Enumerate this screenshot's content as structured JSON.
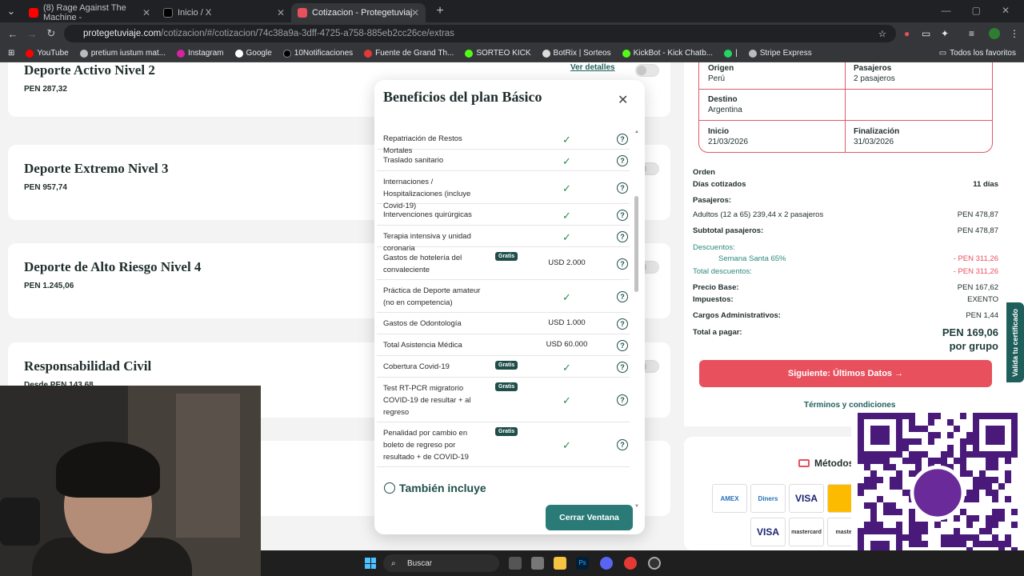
{
  "browser": {
    "tabs": [
      {
        "title": "(8) Rage Against The Machine -",
        "color": "#ff0000"
      },
      {
        "title": "Inicio / X",
        "color": "#000000"
      },
      {
        "title": "Cotizacion - Protegetuviaje.com",
        "color": "#e8505e"
      }
    ],
    "url_host": "protegetuviaje.com",
    "url_path": "/cotizacion/#/cotizacion/74c38a9a-3dff-4725-a758-885eb2cc26ce/extras",
    "bookmarks": [
      "YouTube",
      "pretium iustum mat...",
      "Instagram",
      "Google",
      "10Notificaciones",
      "Fuente de Grand Th...",
      "SORTEO KICK",
      "BotRix | Sorteos",
      "KickBot - Kick Chatb...",
      "|",
      "Stripe Express"
    ],
    "all_bookmarks": "Todos los favoritos"
  },
  "plans": [
    {
      "name": "Deporte Activo Nivel 2",
      "price": "PEN 287,32"
    },
    {
      "name": "Deporte Extremo Nivel 3",
      "price": "PEN 957,74"
    },
    {
      "name": "Deporte de Alto Riesgo Nivel 4",
      "price": "PEN 1.245,06"
    },
    {
      "name": "Responsabilidad Civil",
      "price": "Desde PEN 143,68"
    }
  ],
  "ver_detalles": "Ver detalles",
  "modal": {
    "title": "Beneficios del plan Básico",
    "benefits": [
      {
        "label": "Repatriación de Restos Mortales",
        "value": "✓",
        "gratis": ""
      },
      {
        "label": "Traslado sanitario",
        "value": "✓",
        "gratis": ""
      },
      {
        "label": "Internaciones / Hospitalizaciones (incluye Covid-19)",
        "value": "✓",
        "gratis": ""
      },
      {
        "label": "Intervenciones quirúrgicas",
        "value": "✓",
        "gratis": ""
      },
      {
        "label": "Terapia intensiva y unidad coronaria",
        "value": "✓",
        "gratis": ""
      },
      {
        "label": "Gastos de hotelería del convaleciente",
        "value": "USD 2.000",
        "gratis": "Gratis"
      },
      {
        "label": "Práctica de Deporte amateur (no en competencia)",
        "value": "✓",
        "gratis": ""
      },
      {
        "label": "Gastos de Odontología",
        "value": "USD 1.000",
        "gratis": ""
      },
      {
        "label": "Total Asistencia Médica",
        "value": "USD 60.000",
        "gratis": ""
      },
      {
        "label": "Cobertura Covid-19",
        "value": "✓",
        "gratis": "Gratis"
      },
      {
        "label": "Test RT-PCR migratorio COVID-19 de resultar + al regreso",
        "value": "✓",
        "gratis": "Gratis"
      },
      {
        "label": "Penalidad por cambio en boleto de regreso por resultado + de COVID-19",
        "value": "✓",
        "gratis": "Gratis"
      }
    ],
    "tambien": "También incluye",
    "cerrar": "Cerrar Ventana"
  },
  "summary": {
    "origen_label": "Origen",
    "origen": "Perú",
    "pasajeros_label": "Pasajeros",
    "pasajeros": "2 pasajeros",
    "destino_label": "Destino",
    "destino": "Argentina",
    "inicio_label": "Inicio",
    "inicio": "21/03/2026",
    "fin_label": "Finalización",
    "fin": "31/03/2026",
    "orden": "Orden",
    "dias_label": "Días cotizados",
    "dias": "11 días",
    "pasajeros_head": "Pasajeros:",
    "adultos_label": "Adultos (12 a 65) 239,44 x 2 pasajeros",
    "adultos": "PEN 478,87",
    "subtotal_label": "Subtotal pasajeros:",
    "subtotal": "PEN 478,87",
    "descuentos_label": "Descuentos:",
    "semana_label": "Semana Santa 65%",
    "semana": "- PEN 311,26",
    "total_desc_label": "Total descuentos:",
    "total_desc": "- PEN 311,26",
    "base_label": "Precio Base:",
    "base": "PEN 167,62",
    "impuestos_label": "Impuestos:",
    "impuestos": "EXENTO",
    "cargos_label": "Cargos Administrativos:",
    "cargos": "PEN 1,44",
    "total_label": "Total a pagar:",
    "total": "PEN 169,06",
    "por_grupo": "por grupo",
    "siguiente": "Siguiente: Últimos Datos →",
    "terminos": "Términos y condiciones",
    "valida": "Valida tu certificado",
    "metodos": "Métodos",
    "cards": [
      "AMEX",
      "Diners",
      "VISA",
      "",
      "VISA",
      "mastercard",
      "master"
    ]
  },
  "taskbar": {
    "search": "Buscar"
  }
}
